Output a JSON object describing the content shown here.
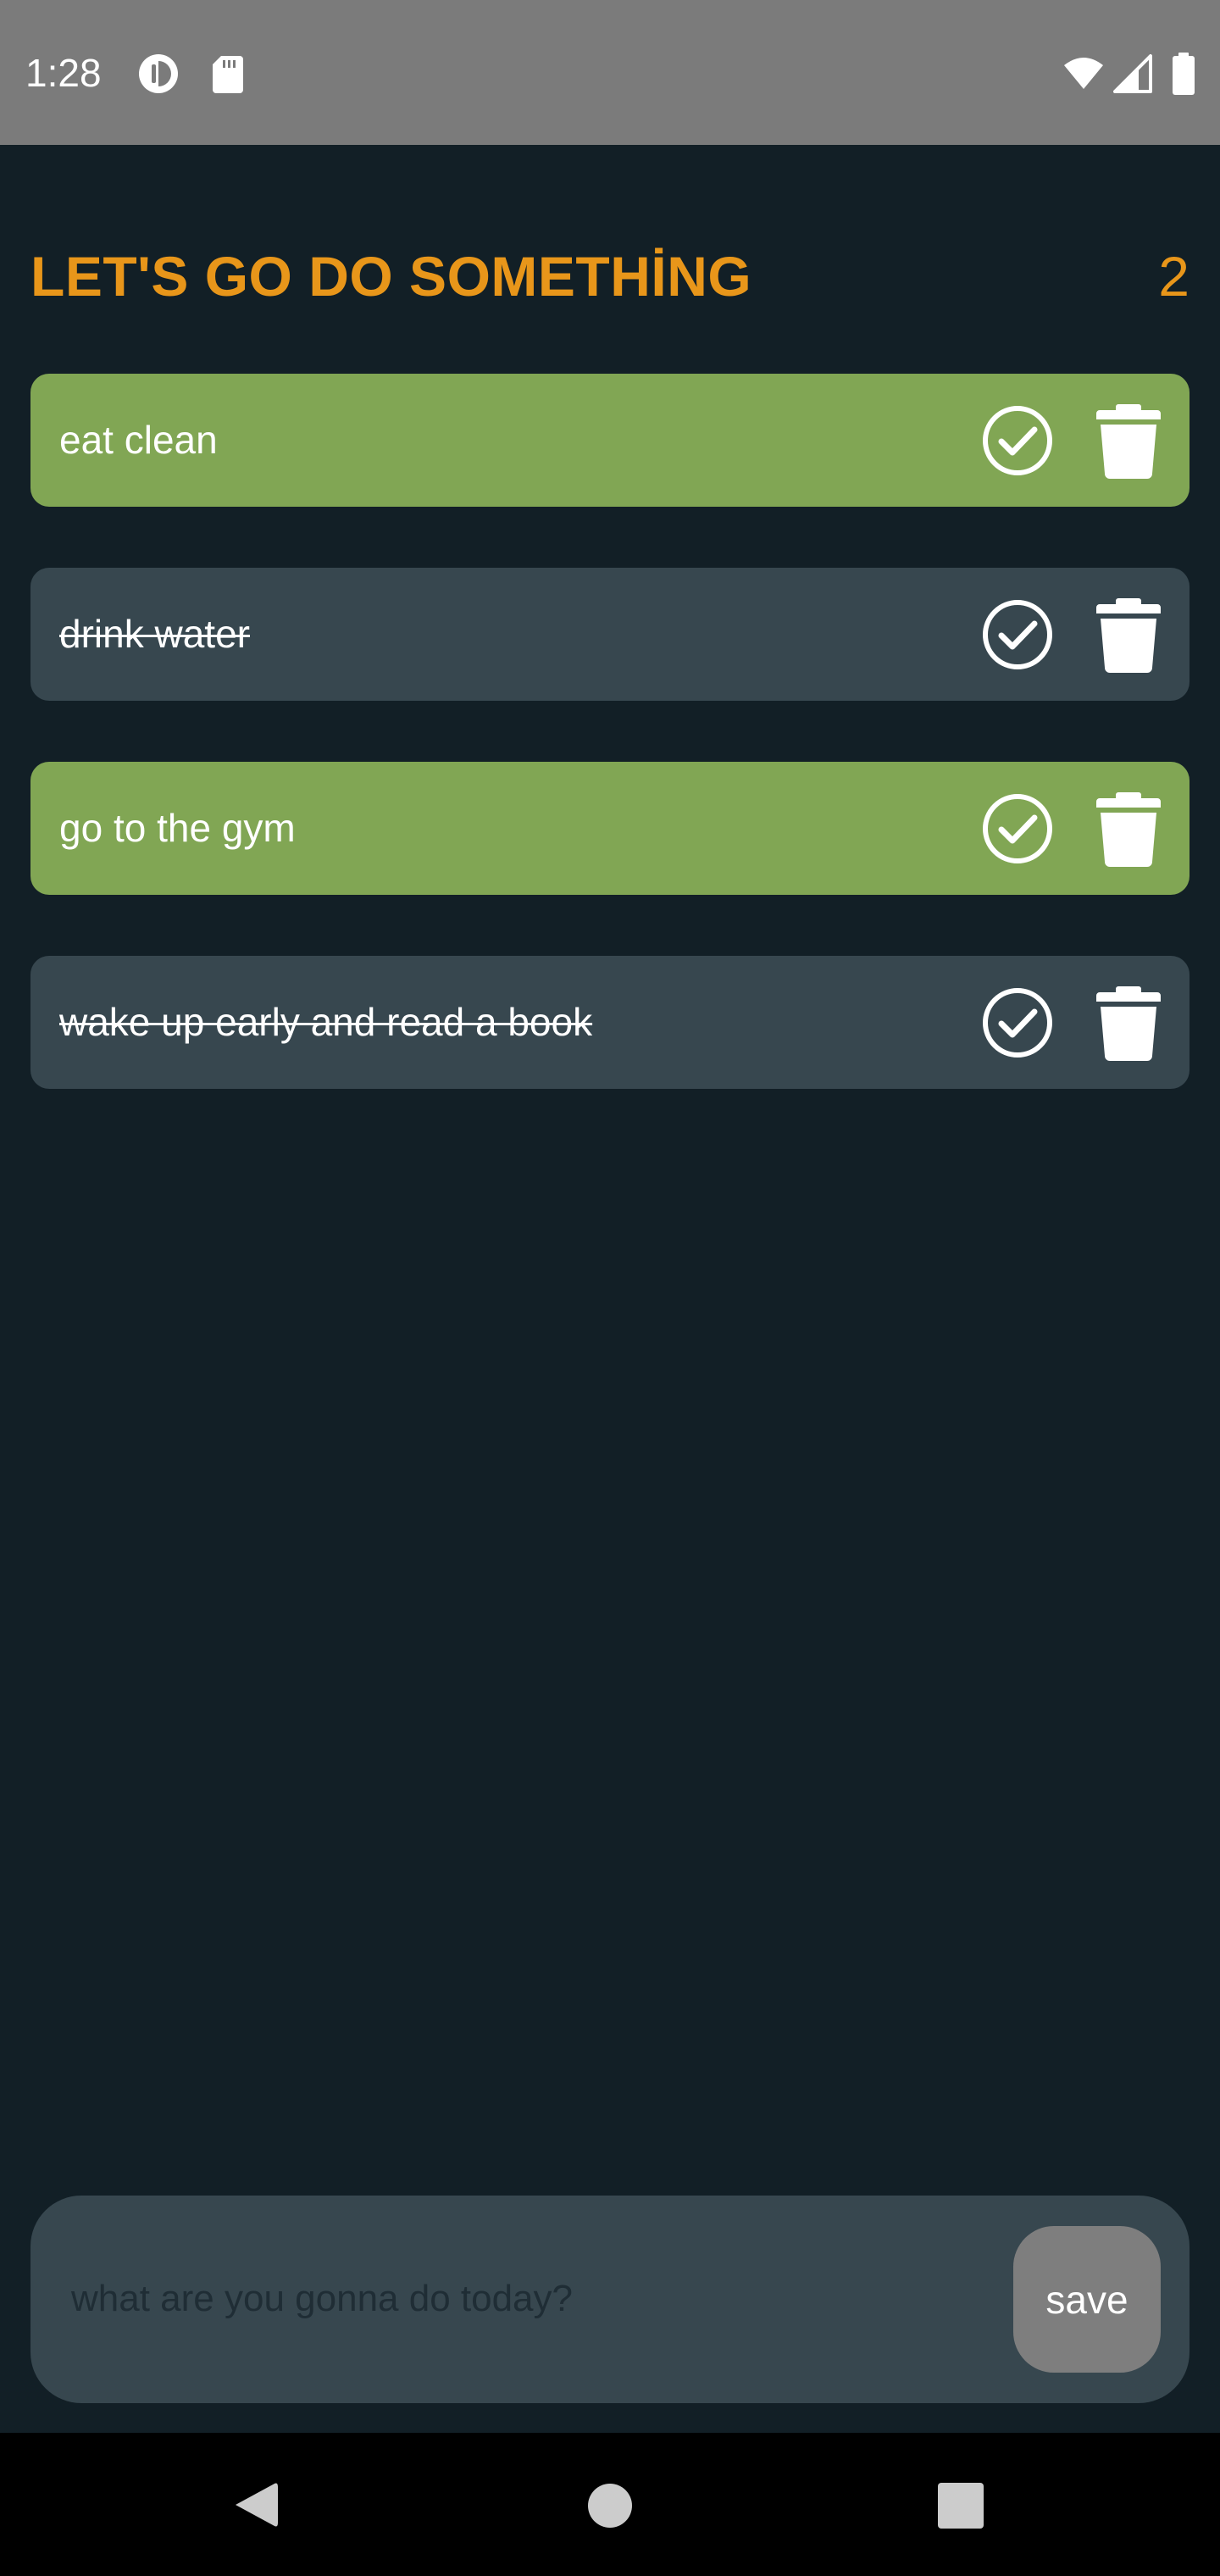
{
  "status_bar": {
    "time": "1:28",
    "left_icons": [
      "data-saver-icon",
      "sd-card-icon"
    ],
    "right_icons": [
      "wifi-icon",
      "signal-icon",
      "battery-icon"
    ],
    "background": "#7b7b7b"
  },
  "header": {
    "title": "LET'S GO DO SOMETHİNG",
    "count": "2",
    "accent_color": "#e8961a"
  },
  "todos": [
    {
      "text": "eat clean",
      "completed": false
    },
    {
      "text": "drink water ",
      "completed": true
    },
    {
      "text": "go to the gym",
      "completed": false
    },
    {
      "text": "wake up early and read a book",
      "completed": true
    }
  ],
  "item_icons": {
    "toggle": "check-circle-icon",
    "delete": "trash-icon"
  },
  "colors": {
    "background": "#121f26",
    "active_item": "#81a654",
    "done_item": "#37474f",
    "input_bar": "#37474f",
    "save_button": "#7e7e7e"
  },
  "input": {
    "value": "",
    "placeholder": "what are you gonna do today?"
  },
  "save_button": {
    "label": "save"
  },
  "nav_bar": {
    "icons": [
      "back-icon",
      "home-icon",
      "recents-icon"
    ]
  }
}
